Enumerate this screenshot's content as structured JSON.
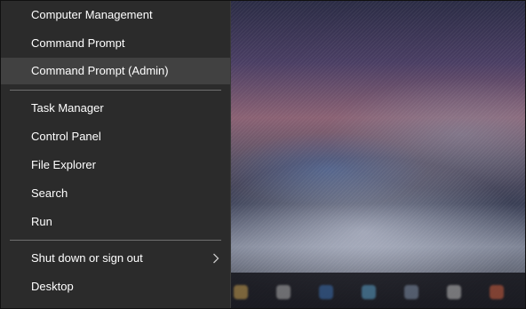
{
  "menu": {
    "group1": [
      {
        "label": "Computer Management"
      },
      {
        "label": "Command Prompt"
      },
      {
        "label": "Command Prompt (Admin)",
        "highlighted": true
      }
    ],
    "group2": [
      {
        "label": "Task Manager"
      },
      {
        "label": "Control Panel"
      },
      {
        "label": "File Explorer"
      },
      {
        "label": "Search"
      },
      {
        "label": "Run"
      }
    ],
    "group3": [
      {
        "label": "Shut down or sign out",
        "submenu_icon": "chevron-right-icon"
      },
      {
        "label": "Desktop"
      }
    ]
  },
  "colors": {
    "menu_background": "#2b2b2b",
    "highlight": "#414141",
    "text": "#ffffff",
    "divider": "#6f6f6f"
  }
}
